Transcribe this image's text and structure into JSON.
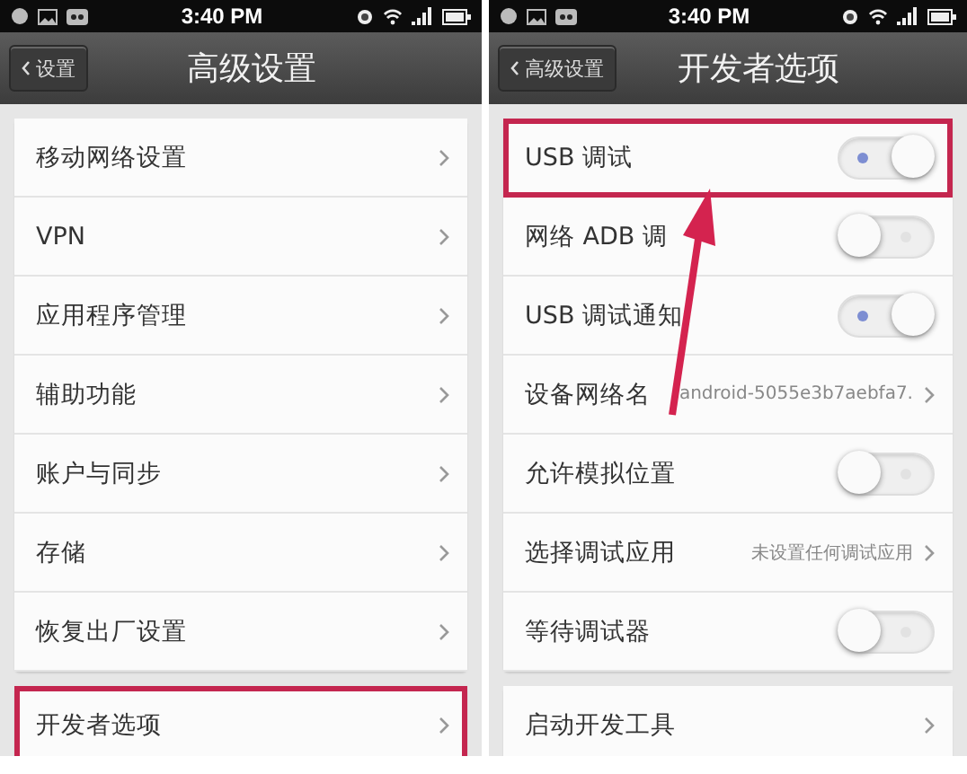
{
  "panels": [
    {
      "status_bar": {
        "time": "3:40 PM"
      },
      "back_button": "设置",
      "title": "高级设置",
      "groups": [
        {
          "items": [
            {
              "kind": "link",
              "label": "移动网络设置",
              "highlighted": false
            },
            {
              "kind": "link",
              "label": "VPN",
              "highlighted": false
            },
            {
              "kind": "link",
              "label": "应用程序管理",
              "highlighted": false
            },
            {
              "kind": "link",
              "label": "辅助功能",
              "highlighted": false
            },
            {
              "kind": "link",
              "label": "账户与同步",
              "highlighted": false
            },
            {
              "kind": "link",
              "label": "存储",
              "highlighted": false
            },
            {
              "kind": "link",
              "label": "恢复出厂设置",
              "highlighted": false
            }
          ]
        },
        {
          "items": [
            {
              "kind": "link",
              "label": "开发者选项",
              "highlighted": true
            }
          ]
        }
      ]
    },
    {
      "status_bar": {
        "time": "3:40 PM"
      },
      "back_button": "高级设置",
      "title": "开发者选项",
      "groups": [
        {
          "items": [
            {
              "kind": "toggle",
              "label": "USB 调试",
              "on": true,
              "highlighted": true
            },
            {
              "kind": "toggle",
              "label": "网络 ADB 调",
              "on": false,
              "highlighted": false
            },
            {
              "kind": "toggle",
              "label": "USB 调试通知",
              "on": true,
              "highlighted": false
            },
            {
              "kind": "link",
              "label": "设备网络名",
              "value": "android-5055e3b7aebfa7.",
              "highlighted": false
            },
            {
              "kind": "toggle",
              "label": "允许模拟位置",
              "on": false,
              "highlighted": false
            },
            {
              "kind": "link",
              "label": "选择调试应用",
              "value": "未设置任何调试应用",
              "highlighted": false
            },
            {
              "kind": "toggle",
              "label": "等待调试器",
              "on": false,
              "highlighted": false
            }
          ]
        },
        {
          "items": [
            {
              "kind": "link",
              "label": "启动开发工具",
              "highlighted": false
            }
          ]
        }
      ]
    }
  ]
}
